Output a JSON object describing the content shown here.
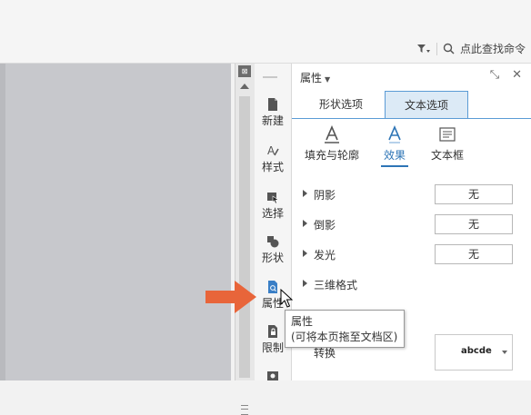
{
  "toolbar": {
    "find_command_label": "点此查找命令"
  },
  "sidebar": {
    "items": [
      {
        "label": "新建",
        "icon": "new-document-icon"
      },
      {
        "label": "样式",
        "icon": "style-icon"
      },
      {
        "label": "选择",
        "icon": "select-icon"
      },
      {
        "label": "形状",
        "icon": "shapes-icon"
      },
      {
        "label": "属性",
        "icon": "properties-icon"
      },
      {
        "label": "限制",
        "icon": "restrict-icon"
      }
    ]
  },
  "properties": {
    "title": "属性",
    "tabs": [
      {
        "label": "形状选项",
        "active": false
      },
      {
        "label": "文本选项",
        "active": true
      }
    ],
    "subtabs": [
      {
        "label": "填充与轮廓",
        "active": false
      },
      {
        "label": "效果",
        "active": true
      },
      {
        "label": "文本框",
        "active": false
      }
    ],
    "effects": [
      {
        "label": "阴影",
        "value": "无"
      },
      {
        "label": "倒影",
        "value": "无"
      },
      {
        "label": "发光",
        "value": "无"
      },
      {
        "label": "三维格式",
        "value": ""
      }
    ],
    "transform": {
      "label": "转换",
      "preset": "abcde"
    }
  },
  "tooltip": {
    "title": "属性",
    "desc": "(可将本页拖至文档区)"
  },
  "colors": {
    "accent": "#2e75b6",
    "arrow": "#e8653a",
    "canvas": "#c7c8cc"
  }
}
